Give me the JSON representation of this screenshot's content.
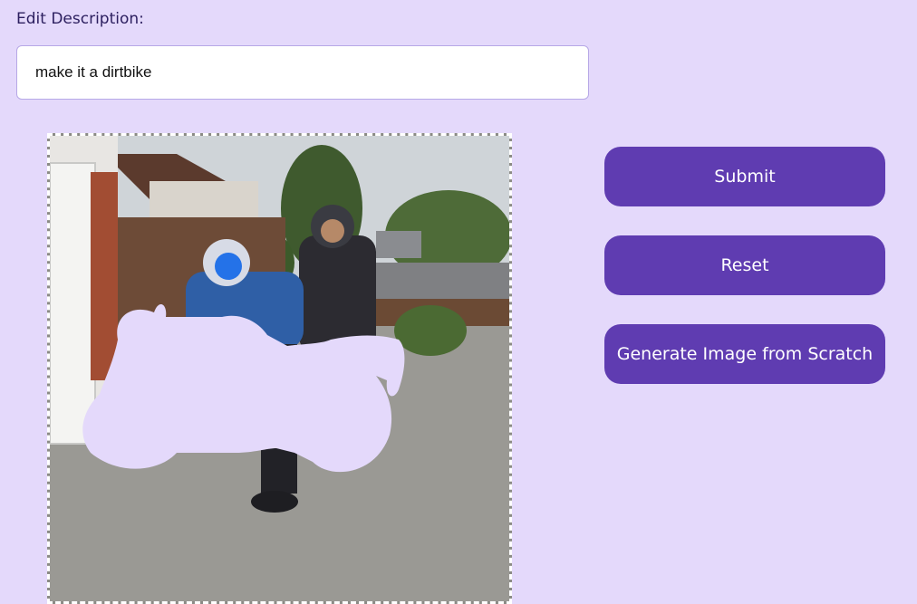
{
  "edit": {
    "label": "Edit Description:",
    "value": "make it a dirtbike"
  },
  "canvas": {
    "photo_description": "",
    "mask_color": "#e4d9fb"
  },
  "buttons": {
    "submit": "Submit",
    "reset": "Reset",
    "generate": "Generate Image from Scratch"
  },
  "colors": {
    "background": "#e4d9fb",
    "button": "#5f3cb1",
    "button_text": "#ffffff"
  }
}
